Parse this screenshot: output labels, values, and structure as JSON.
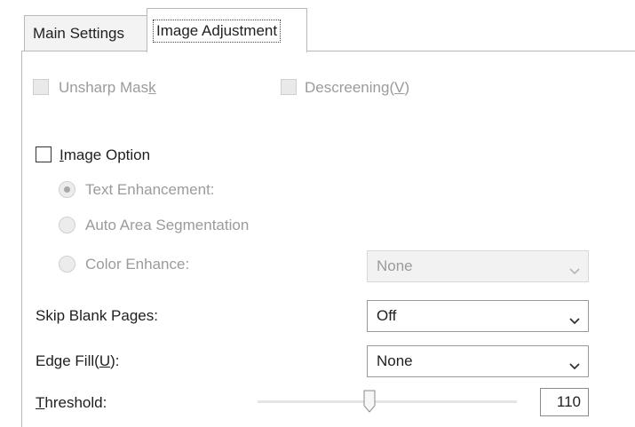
{
  "tabs": {
    "main_settings": "Main Settings",
    "image_adjustment": "Image Adjustment"
  },
  "options": {
    "unsharp_mask": {
      "label_pre": "Unsharp Mas",
      "label_key": "k",
      "checked": false,
      "enabled": false
    },
    "descreening": {
      "label_pre": "Descreening(",
      "label_key": "V",
      "label_post": ")",
      "checked": false,
      "enabled": false
    },
    "image_option": {
      "label_pre": "",
      "label_key": "I",
      "label_post": "mage Option",
      "checked": false,
      "enabled": true
    }
  },
  "image_option_modes": {
    "text_enhancement": {
      "label": "Text Enhancement:",
      "selected": true,
      "enabled": false
    },
    "auto_area_segmentation": {
      "label": "Auto Area Segmentation",
      "selected": false,
      "enabled": false
    },
    "color_enhance": {
      "label": "Color Enhance:",
      "selected": false,
      "enabled": false,
      "select_value": "None"
    }
  },
  "skip_blank_pages": {
    "label": "Skip Blank Pages:",
    "value": "Off"
  },
  "edge_fill": {
    "label_pre": "Edge Fill(",
    "label_key": "U",
    "label_post": "):",
    "value": "None"
  },
  "threshold": {
    "label_key": "T",
    "label_post": "hreshold:",
    "value": "110",
    "min": 0,
    "max": 255
  },
  "colors": {
    "disabled_text": "#9b9b9b",
    "border": "#b9b9b9"
  },
  "icons": {
    "dropdown": "chevron-down-icon",
    "slider_thumb": "slider-thumb-icon"
  }
}
